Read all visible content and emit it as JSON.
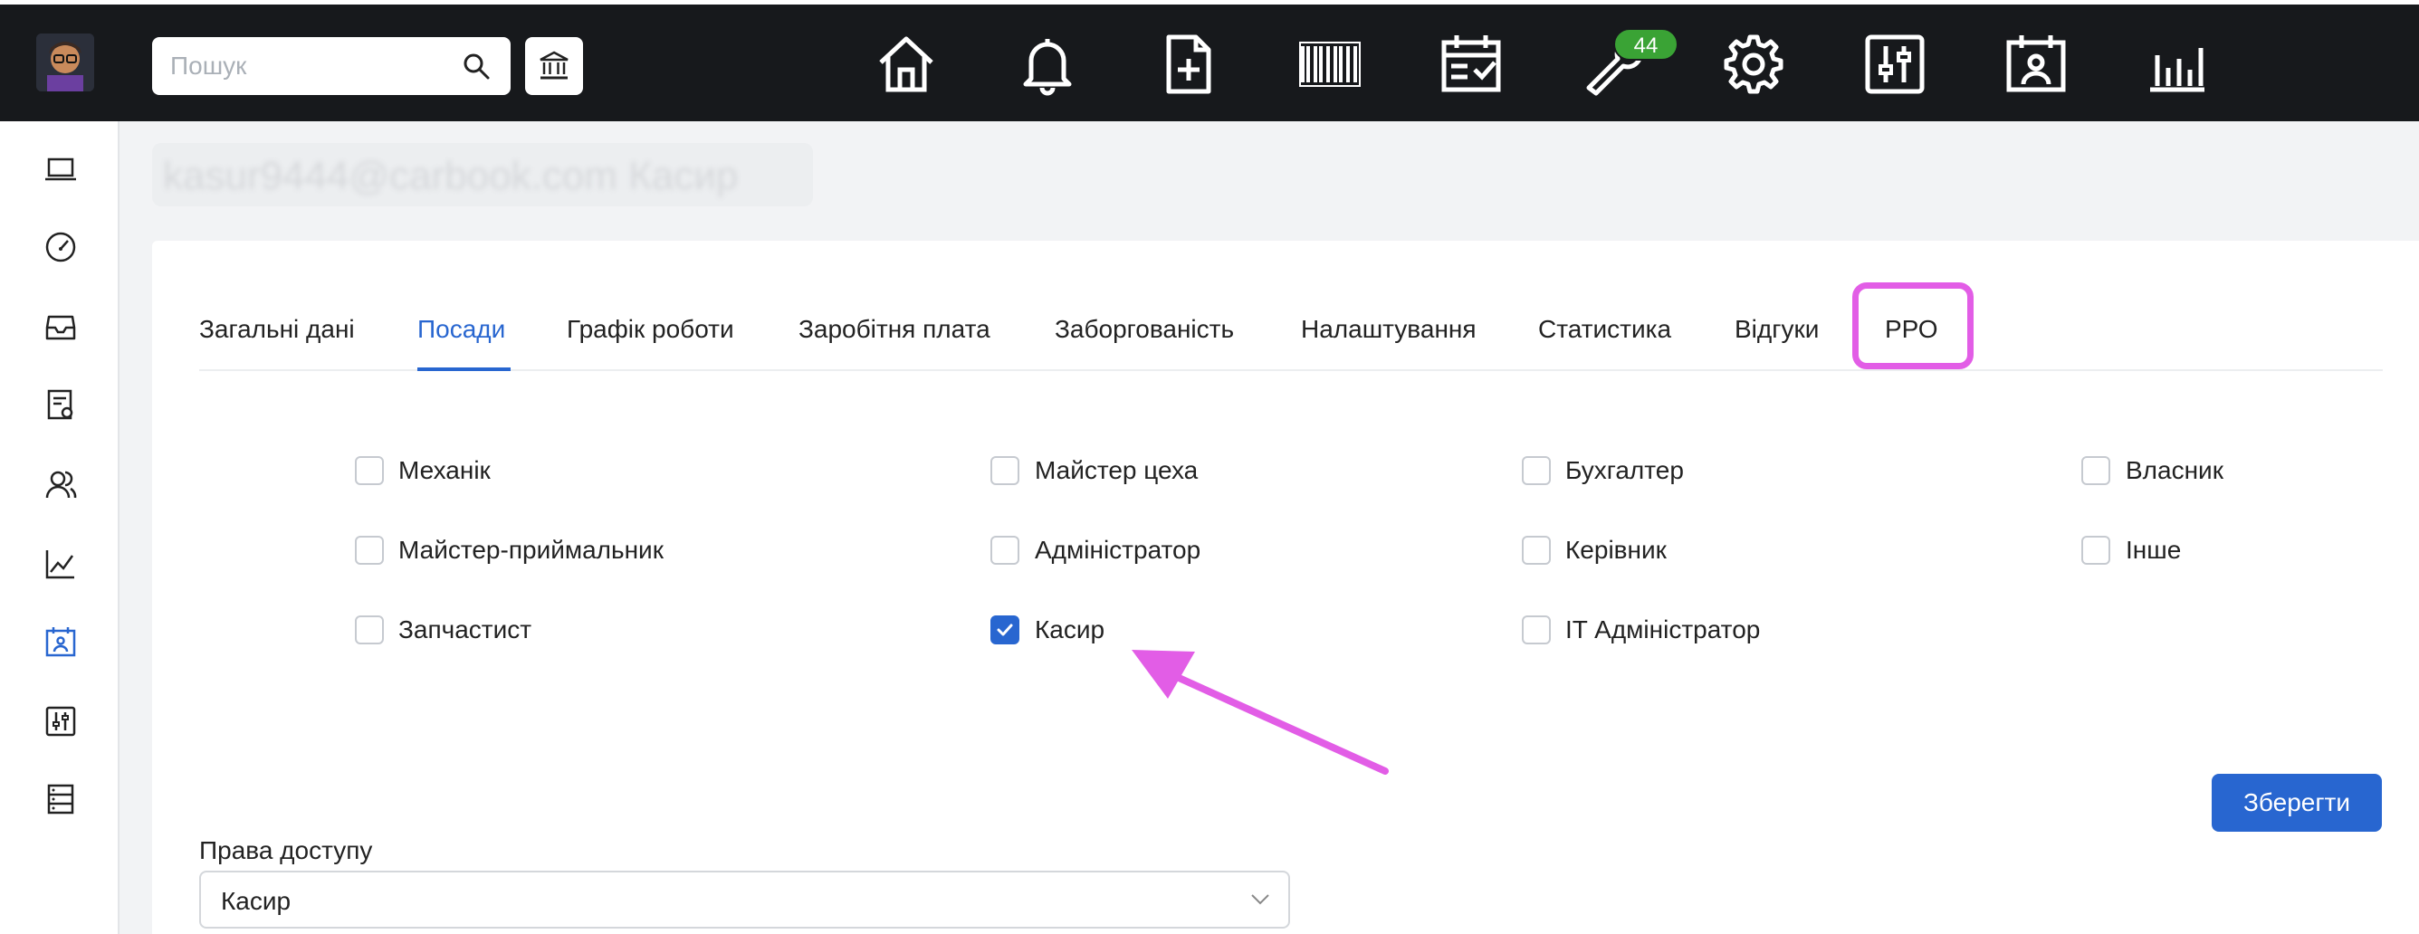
{
  "search": {
    "placeholder": "Пошук"
  },
  "header": {
    "badge_count": "44",
    "blurred_title": "kasur9444@carbook.com Касир"
  },
  "tabs": [
    {
      "label": "Загальні дані"
    },
    {
      "label": "Посади"
    },
    {
      "label": "Графік роботи"
    },
    {
      "label": "Заробітня плата"
    },
    {
      "label": "Заборгованість"
    },
    {
      "label": "Налаштування"
    },
    {
      "label": "Статистика"
    },
    {
      "label": "Відгуки"
    },
    {
      "label": "РРО"
    }
  ],
  "active_tab": "Посади",
  "positions": [
    {
      "label": "Механік",
      "checked": false
    },
    {
      "label": "Майстер цеха",
      "checked": false
    },
    {
      "label": "Бухгалтер",
      "checked": false
    },
    {
      "label": "Власник",
      "checked": false
    },
    {
      "label": "Майстер-приймальник",
      "checked": false
    },
    {
      "label": "Адміністратор",
      "checked": false
    },
    {
      "label": "Керівник",
      "checked": false
    },
    {
      "label": "Інше",
      "checked": false
    },
    {
      "label": "Запчастист",
      "checked": false
    },
    {
      "label": "Касир",
      "checked": true
    },
    {
      "label": "IT Адміністратор",
      "checked": false
    }
  ],
  "save_label": "Зберегти",
  "access": {
    "label": "Права доступу",
    "value": "Касир"
  },
  "colors": {
    "accent": "#2866d0",
    "highlight": "#e25de6",
    "topbar": "#17191c",
    "badge": "#3aa335"
  }
}
